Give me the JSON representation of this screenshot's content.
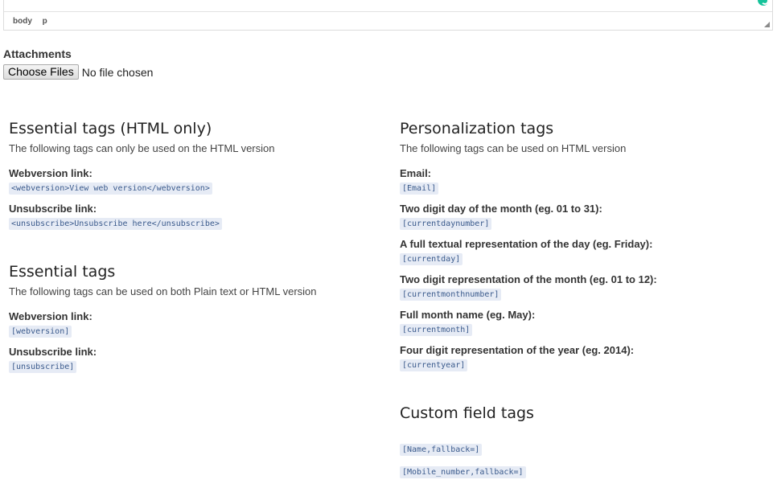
{
  "editor": {
    "path": [
      "body",
      "p"
    ]
  },
  "attachments": {
    "label": "Attachments",
    "button_label": "Choose Files",
    "status": "No file chosen"
  },
  "left": {
    "html_only": {
      "title": "Essential tags (HTML only)",
      "description": "The following tags can only be used on the HTML version",
      "items": [
        {
          "label": "Webversion link:",
          "code": "<webversion>View web version</webversion>"
        },
        {
          "label": "Unsubscribe link:",
          "code": "<unsubscribe>Unsubscribe here</unsubscribe>"
        }
      ]
    },
    "essential": {
      "title": "Essential tags",
      "description": "The following tags can be used on both Plain text or HTML version",
      "items": [
        {
          "label": "Webversion link:",
          "code": "[webversion]"
        },
        {
          "label": "Unsubscribe link:",
          "code": "[unsubscribe]"
        }
      ]
    }
  },
  "right": {
    "personalization": {
      "title": "Personalization tags",
      "description": "The following tags can be used on HTML version",
      "items": [
        {
          "label": "Email:",
          "code": "[Email]"
        },
        {
          "label": "Two digit day of the month (eg. 01 to 31):",
          "code": "[currentdaynumber]"
        },
        {
          "label": "A full textual representation of the day (eg. Friday):",
          "code": "[currentday]"
        },
        {
          "label": "Two digit representation of the month (eg. 01 to 12):",
          "code": "[currentmonthnumber]"
        },
        {
          "label": "Full month name (eg. May):",
          "code": "[currentmonth]"
        },
        {
          "label": "Four digit representation of the year (eg. 2014):",
          "code": "[currentyear]"
        }
      ]
    },
    "custom": {
      "title": "Custom field tags",
      "items": [
        {
          "code": "[Name,fallback=]"
        },
        {
          "code": "[Mobile_number,fallback=]"
        }
      ]
    }
  }
}
